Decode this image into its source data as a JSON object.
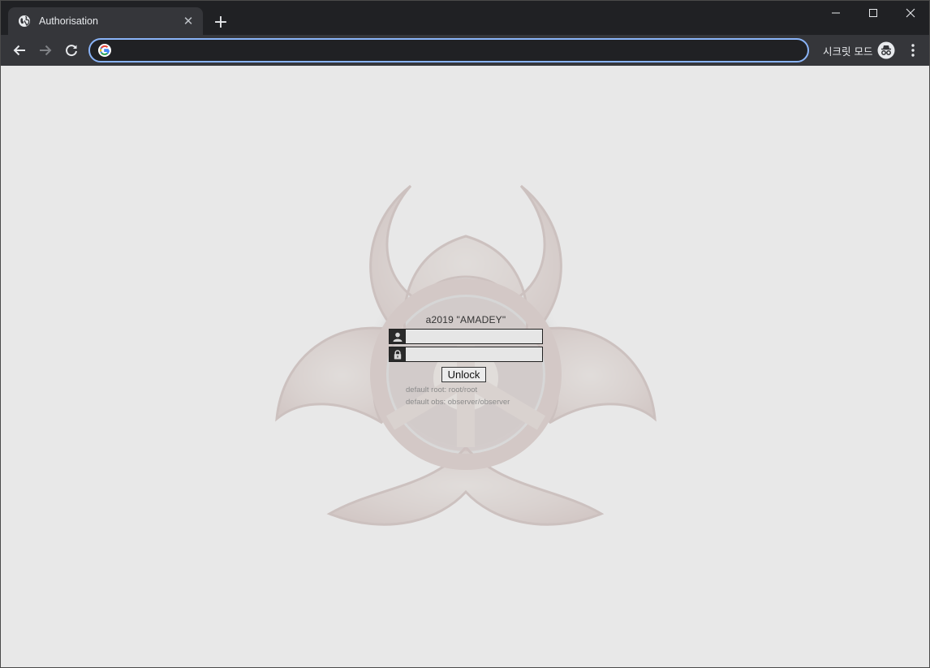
{
  "browser": {
    "tab": {
      "title": "Authorisation",
      "close": "✕",
      "favicon": "globe-icon"
    },
    "new_tab": "+",
    "address": {
      "value": "",
      "favicon": "google-g-icon"
    },
    "incognito": {
      "label": "시크릿 모드",
      "icon": "incognito-icon"
    },
    "colors": {
      "tabstrip": "#202124",
      "toolbar": "#35363a",
      "focus": "#8ab4f8"
    }
  },
  "page": {
    "title": "a2019 \"AMADEY\"",
    "username": {
      "value": "",
      "icon": "user-icon"
    },
    "password": {
      "value": "",
      "icon": "lock-icon"
    },
    "unlock_label": "Unlock",
    "hints": [
      "default root: root/root",
      "default obs: observer/observer"
    ],
    "background_image": "biohazard-symbol",
    "colors": {
      "background": "#e8e8e8",
      "symbol": "#7a4038"
    }
  }
}
